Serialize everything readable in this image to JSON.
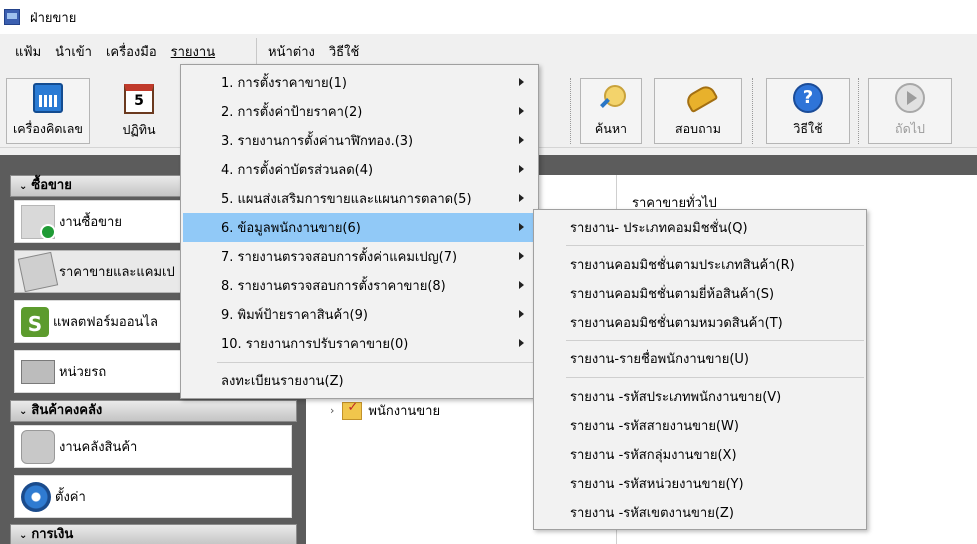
{
  "window": {
    "title": "ฝ่ายขาย"
  },
  "menubar": {
    "items": [
      {
        "label": "แฟ้ม"
      },
      {
        "label": "นำเข้า"
      },
      {
        "label": "เครื่องมือ"
      },
      {
        "label": "รายงาน"
      },
      {
        "label": "หน้าต่าง"
      },
      {
        "label": "วิธีใช้"
      }
    ]
  },
  "toolbar": {
    "calculator": "เครื่องคิดเลข",
    "calendar": "ปฏิทิน",
    "calendar_day": "5",
    "search": "ค้นหา",
    "inquiry": "สอบถาม",
    "help": "วิธีใช้",
    "next": "ถัดไป"
  },
  "sidebar": {
    "sections": [
      {
        "title": "ซื้อขาย"
      },
      {
        "title": "สินค้าคงคลัง"
      },
      {
        "title": "การเงิน"
      }
    ],
    "items": [
      {
        "label": "งานซื้อขาย",
        "icon": "document-add-icon"
      },
      {
        "label": "ราคาขายและแคมเป",
        "icon": "price-tag-icon"
      },
      {
        "label": "แพลตฟอร์มออนไล",
        "icon": "shopify-icon"
      },
      {
        "label": "หน่วยรถ",
        "icon": "truck-icon"
      },
      {
        "label": "งานคลังสินค้า",
        "icon": "warehouse-icon"
      },
      {
        "label": "ตั้งค่า",
        "icon": "gear-icon"
      }
    ]
  },
  "main": {
    "tree_node": "พนักงานขาย",
    "right_caption": "ราคาขายทั่วไป"
  },
  "report_menu": {
    "items": [
      {
        "label": "1. การตั้งราคาขาย(1)"
      },
      {
        "label": "2. การตั้งค่าป้ายราคา(2)"
      },
      {
        "label": "3. รายงานการตั้งค่านาฬิกทอง.(3)"
      },
      {
        "label": "4. การตั้งค่าบัตรส่วนลด(4)"
      },
      {
        "label": "5. แผนส่งเสริมการขายและแผนการตลาด(5)"
      },
      {
        "label": "6. ข้อมูลพนักงานขาย(6)"
      },
      {
        "label": "7. รายงานตรวจสอบการตั้งค่าแคมเปญ(7)"
      },
      {
        "label": "8. รายงานตรวจสอบการตั้งราคาขาย(8)"
      },
      {
        "label": "9. พิมพ์ป้ายราคาสินค้า(9)"
      },
      {
        "label": "10. รายงานการปรับราคาขาย(0)"
      }
    ],
    "register": "ลงทะเบียนรายงาน(Z)"
  },
  "employee_submenu": {
    "items": [
      {
        "label": "รายงาน- ประเภทคอมมิชชั่น(Q)"
      },
      {
        "label": "รายงานคอมมิชชั่นตามประเภทสินค้า(R)"
      },
      {
        "label": "รายงานคอมมิชชั่นตามยี่ห้อสินค้า(S)"
      },
      {
        "label": "รายงานคอมมิชชั่นตามหมวดสินค้า(T)"
      },
      {
        "label": "รายงาน-รายชื่อพนักงานขาย(U)"
      },
      {
        "label": "รายงาน -รหัสประเภทพนักงานขาย(V)"
      },
      {
        "label": "รายงาน -รหัสสายงานขาย(W)"
      },
      {
        "label": "รายงาน -รหัสกลุ่มงานขาย(X)"
      },
      {
        "label": "รายงาน -รหัสหน่วยงานขาย(Y)"
      },
      {
        "label": "รายงาน -รหัสเขตงานขาย(Z)"
      }
    ]
  },
  "colors": {
    "highlight": "#91c9f7",
    "sidebar_bg": "#5c5c5c",
    "menu_bg": "#f2f2f2"
  }
}
